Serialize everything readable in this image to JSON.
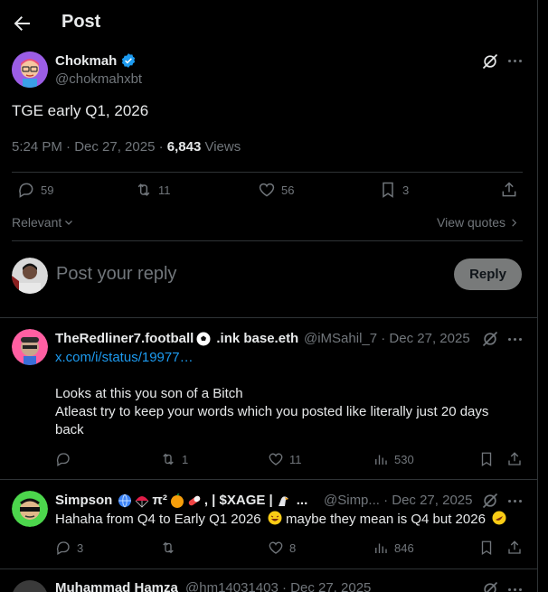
{
  "header": {
    "title": "Post"
  },
  "post": {
    "author": "Chokmah",
    "handle": "@chokmahxbt",
    "text": "TGE early Q1, 2026",
    "time": "5:24 PM · Dec 27, 2025 · ",
    "views_count": "6,843",
    "views_label": " Views",
    "replies": "59",
    "reposts": "11",
    "likes": "56",
    "bookmarks": "3"
  },
  "sort": {
    "label": "Relevant",
    "view_quotes": "View quotes"
  },
  "composer": {
    "placeholder": "Post your reply",
    "button": "Reply"
  },
  "replies": [
    {
      "name": "TheRedliner7.football",
      "name_suffix": ".ink base.eth",
      "handle": "@iMSahil_7",
      "date": "· Dec 27, 2025",
      "link": "x.com/i/status/19977…",
      "line1": "Looks at this you son of a Bitch",
      "line2": "Atleast try to keep your words which you posted like literally just 20 days",
      "line3": "back",
      "reposts": "1",
      "likes": "11",
      "views": "530"
    },
    {
      "name": "Simpson",
      "name_suffix": "π² ",
      "name_suffix2": ", | $XAGE |",
      "name_ellipsis": "...",
      "handle": "@Simp...",
      "date": "· Dec 27, 2025",
      "text": "Hahaha from Q4 to Early Q1 2026",
      "text2": " maybe they mean is Q4 but 2026",
      "replies": "3",
      "likes": "8",
      "views": "846"
    },
    {
      "name": "Muhammad Hamza",
      "handle": "@hm14031403",
      "date": "· Dec 27, 2025"
    }
  ],
  "colors": {
    "accent": "#1d9bf0",
    "verified": "#1d9bf0",
    "reply_button": "#787a7a"
  }
}
